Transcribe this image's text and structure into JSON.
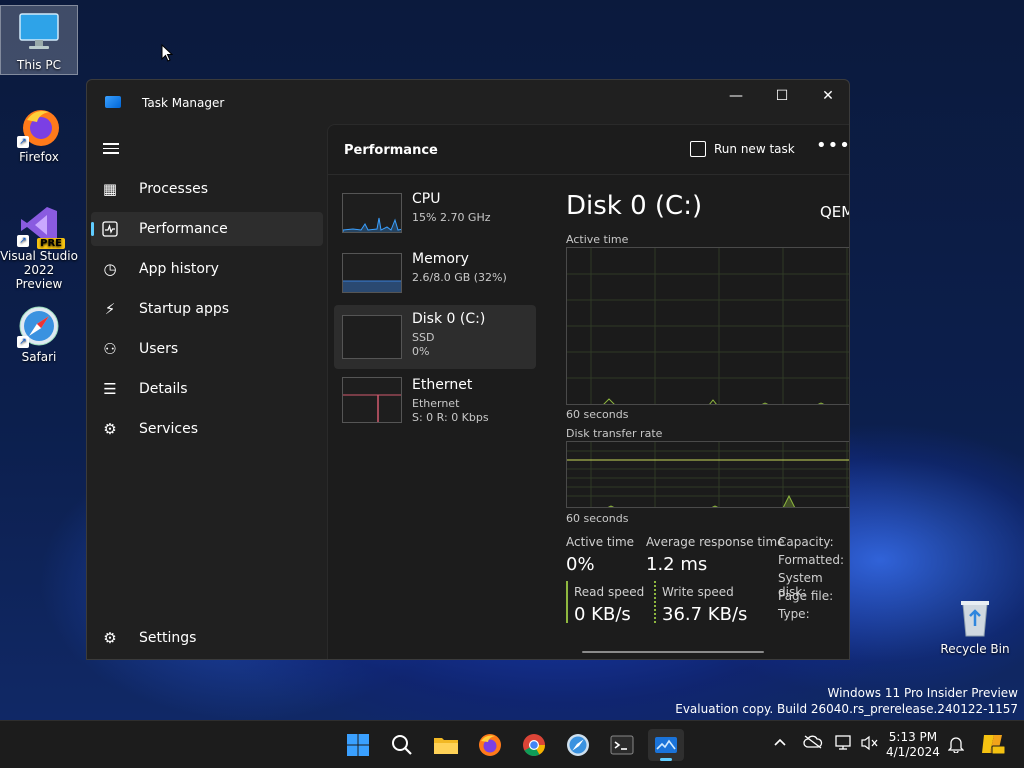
{
  "desktop": {
    "icons": [
      {
        "label": "This PC"
      },
      {
        "label": "Firefox"
      },
      {
        "label": "Visual Studio 2022 Preview"
      },
      {
        "label": "Safari"
      },
      {
        "label": "Recycle Bin"
      }
    ],
    "vs_badge": "PRE",
    "watermark_line1": "Windows 11 Pro Insider Preview",
    "watermark_line2": "Evaluation copy. Build 26040.rs_prerelease.240122-1157"
  },
  "window": {
    "title": "Task Manager",
    "caption": {
      "minimize": "—",
      "maximize": "☐",
      "close": "✕"
    }
  },
  "nav": {
    "items": [
      {
        "label": "Processes",
        "icon": "processes-icon"
      },
      {
        "label": "Performance",
        "icon": "performance-icon"
      },
      {
        "label": "App history",
        "icon": "app-history-icon"
      },
      {
        "label": "Startup apps",
        "icon": "startup-apps-icon"
      },
      {
        "label": "Users",
        "icon": "users-icon"
      },
      {
        "label": "Details",
        "icon": "details-icon"
      },
      {
        "label": "Services",
        "icon": "services-icon"
      }
    ],
    "settings": "Settings",
    "active": "Performance"
  },
  "header": {
    "title": "Performance",
    "run_new_task": "Run new task",
    "more": "•••"
  },
  "resources": [
    {
      "name": "CPU",
      "sub1": "15%  2.70 GHz",
      "sub2": "",
      "color": "#3aa0ff"
    },
    {
      "name": "Memory",
      "sub1": "2.6/8.0 GB (32%)",
      "sub2": "",
      "color": "#3a7fd6"
    },
    {
      "name": "Disk 0 (C:)",
      "sub1": "SSD",
      "sub2": "0%",
      "color": "#8fb83f"
    },
    {
      "name": "Ethernet",
      "sub1": "Ethernet",
      "sub2": "S: 0  R: 0 Kbps",
      "color": "#d15a6e"
    }
  ],
  "detail": {
    "title": "Disk 0 (C:)",
    "model": "QEM",
    "active_time_label": "Active time",
    "seconds_label_1": "60 seconds",
    "transfer_rate_label": "Disk transfer rate",
    "seconds_label_2": "60 seconds",
    "stats": {
      "active_time_label": "Active time",
      "active_time_value": "0%",
      "avg_response_label": "Average response time",
      "avg_response_value": "1.2 ms",
      "read_label": "Read speed",
      "read_value": "0 KB/s",
      "write_label": "Write speed",
      "write_value": "36.7 KB/s"
    },
    "info_keys": [
      "Capacity:",
      "Formatted:",
      "System disk:",
      "Page file:",
      "Type:"
    ],
    "graph_color": "#8fb83f"
  },
  "taskbar": {
    "apps": [
      "start-icon",
      "search-icon",
      "file-explorer-icon",
      "firefox-icon",
      "chrome-icon",
      "safari-icon",
      "terminal-icon",
      "task-manager-icon"
    ],
    "time": "5:13 PM",
    "date": "4/1/2024"
  }
}
